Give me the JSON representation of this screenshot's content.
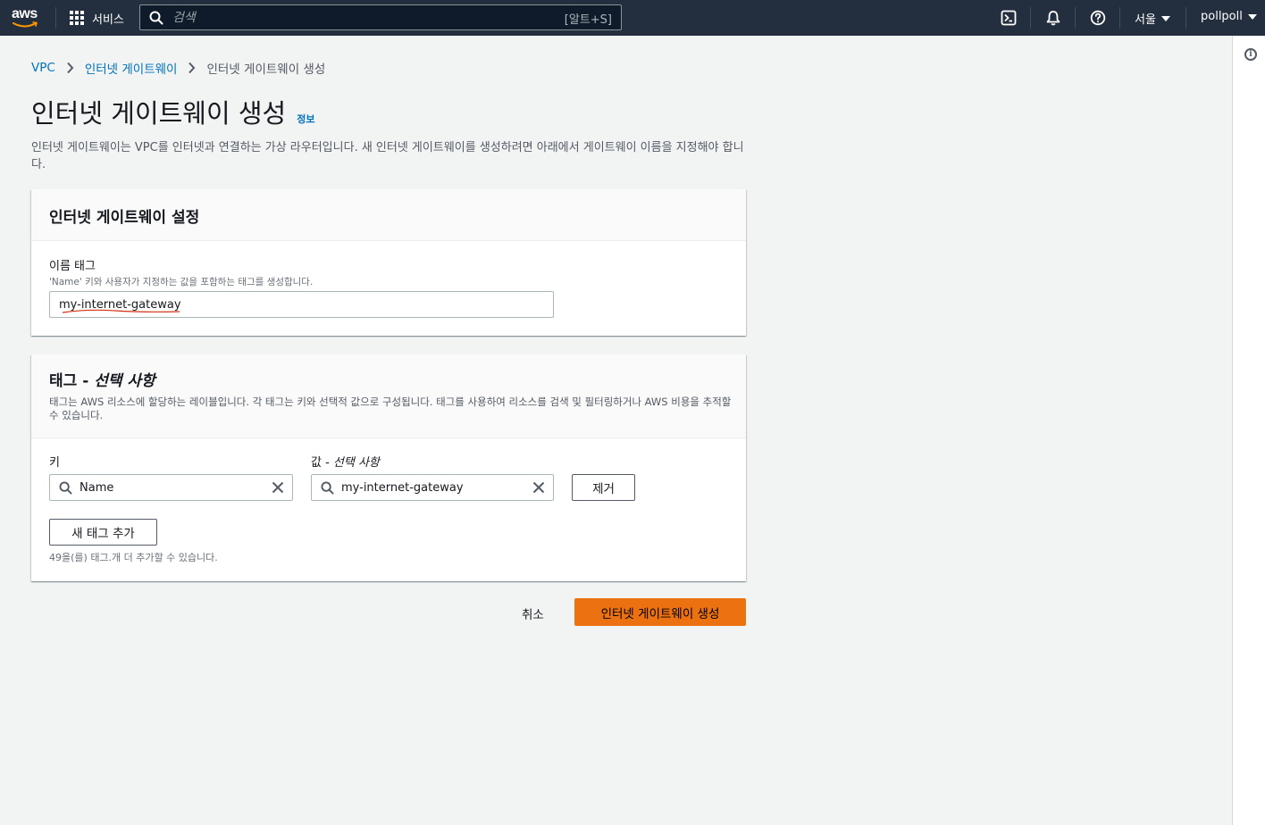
{
  "topnav": {
    "logo_text": "aws",
    "services_label": "서비스",
    "search_placeholder": "검색",
    "search_shortcut": "[알트+S]",
    "region_label": "서울",
    "account_label": "pollpoll"
  },
  "breadcrumb": {
    "items": [
      "VPC",
      "인터넷 게이트웨이",
      "인터넷 게이트웨이 생성"
    ]
  },
  "page": {
    "title": "인터넷 게이트웨이 생성",
    "info_link": "정보",
    "description": "인터넷 게이트웨이는 VPC를 인터넷과 연결하는 가상 라우터입니다. 새 인터넷 게이트웨이를 생성하려면 아래에서 게이트웨이 이름을 지정해야 합니다."
  },
  "settings_panel": {
    "title": "인터넷 게이트웨이 설정",
    "name_tag_label": "이름 태그",
    "name_tag_desc": "'Name' 키와 사용자가 지정하는 값을 포함하는 태그를 생성합니다.",
    "name_tag_value": "my-internet-gateway"
  },
  "tags_panel": {
    "title_main": "태그 - ",
    "title_optional": "선택 사항",
    "description": "태그는 AWS 리소스에 할당하는 레이블입니다. 각 태그는 키와 선택적 값으로 구성됩니다. 태그를 사용하여 리소스를 검색 및 필터링하거나 AWS 비용을 추적할 수 있습니다.",
    "key_label": "키",
    "value_label_main": "값 - ",
    "value_label_optional": "선택 사항",
    "key_value": "Name",
    "value_value": "my-internet-gateway",
    "remove_button": "제거",
    "add_tag_button": "새 태그 추가",
    "limit_hint": "49을(를) 태그.개 더 추가할 수 있습니다."
  },
  "footer": {
    "cancel_button": "취소",
    "create_button": "인터넷 게이트웨이 생성"
  },
  "colors": {
    "nav_bg": "#232f3e",
    "primary_button": "#ec7211",
    "link": "#0073bb"
  }
}
